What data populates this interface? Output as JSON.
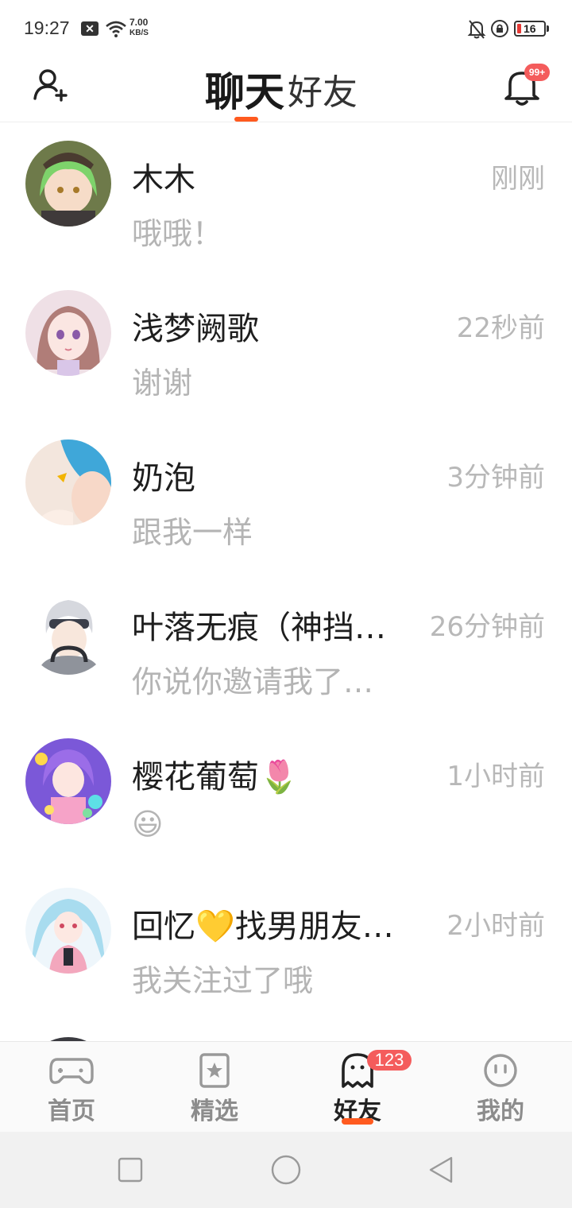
{
  "status_bar": {
    "time": "19:27",
    "speed_value": "7.00",
    "speed_unit": "KB/S",
    "battery_level": "16"
  },
  "header": {
    "tab_chat": "聊天",
    "tab_friends": "好友",
    "notification_badge": "99+"
  },
  "chats": [
    {
      "name": "木木",
      "time": "刚刚",
      "message": "哦哦！"
    },
    {
      "name": "浅梦阙歌",
      "time": "22秒前",
      "message": "谢谢"
    },
    {
      "name": "奶泡",
      "time": "3分钟前",
      "message": "跟我一样"
    },
    {
      "name": "叶落无痕（神挡…",
      "time": "26分钟前",
      "message": "你说你邀请我了…"
    },
    {
      "name": "樱花葡萄🌷",
      "time": "1小时前",
      "message": "😃"
    },
    {
      "name": "回忆💛找男朋友…",
      "time": "2小时前",
      "message": "我关注过了哦"
    }
  ],
  "bottom_nav": {
    "home": "首页",
    "featured": "精选",
    "friends": "好友",
    "friends_badge": "123",
    "me": "我的"
  },
  "colors": {
    "accent": "#ff5a1f",
    "badge": "#f45c5c",
    "muted_text": "#b4b4b4"
  }
}
